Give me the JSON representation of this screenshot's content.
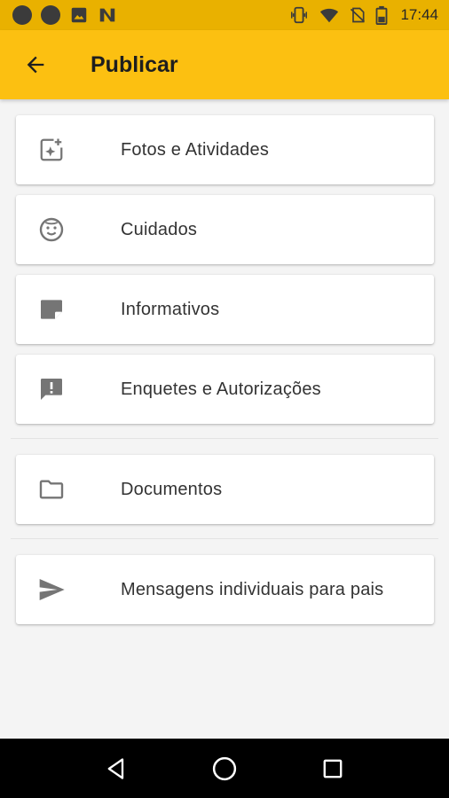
{
  "status_bar": {
    "time": "17:44",
    "left_icons": [
      "notification-dot-icon",
      "notification-dot-icon",
      "image-icon",
      "n-app-icon"
    ],
    "right_icons": [
      "vibrate-icon",
      "wifi-icon",
      "no-sim-icon",
      "battery-icon"
    ]
  },
  "app_bar": {
    "title": "Publicar",
    "background": "#fcc011",
    "back_icon": "arrow-back-icon"
  },
  "menu": {
    "items": [
      {
        "label": "Fotos e Atividades",
        "icon": "add-photo-icon"
      },
      {
        "label": "Cuidados",
        "icon": "smiley-face-icon"
      },
      {
        "label": "Informativos",
        "icon": "note-icon"
      },
      {
        "label": "Enquetes e Autorizações",
        "icon": "feedback-icon"
      },
      {
        "label": "Documentos",
        "icon": "folder-icon"
      },
      {
        "label": "Mensagens individuais para pais",
        "icon": "send-icon"
      }
    ]
  },
  "nav_bar": {
    "buttons": [
      "back-triangle-icon",
      "home-circle-icon",
      "recents-square-icon"
    ]
  },
  "colors": {
    "status_bar": "#e9b100",
    "app_bar": "#fcc011",
    "background": "#f4f4f4",
    "icon": "#757575"
  }
}
